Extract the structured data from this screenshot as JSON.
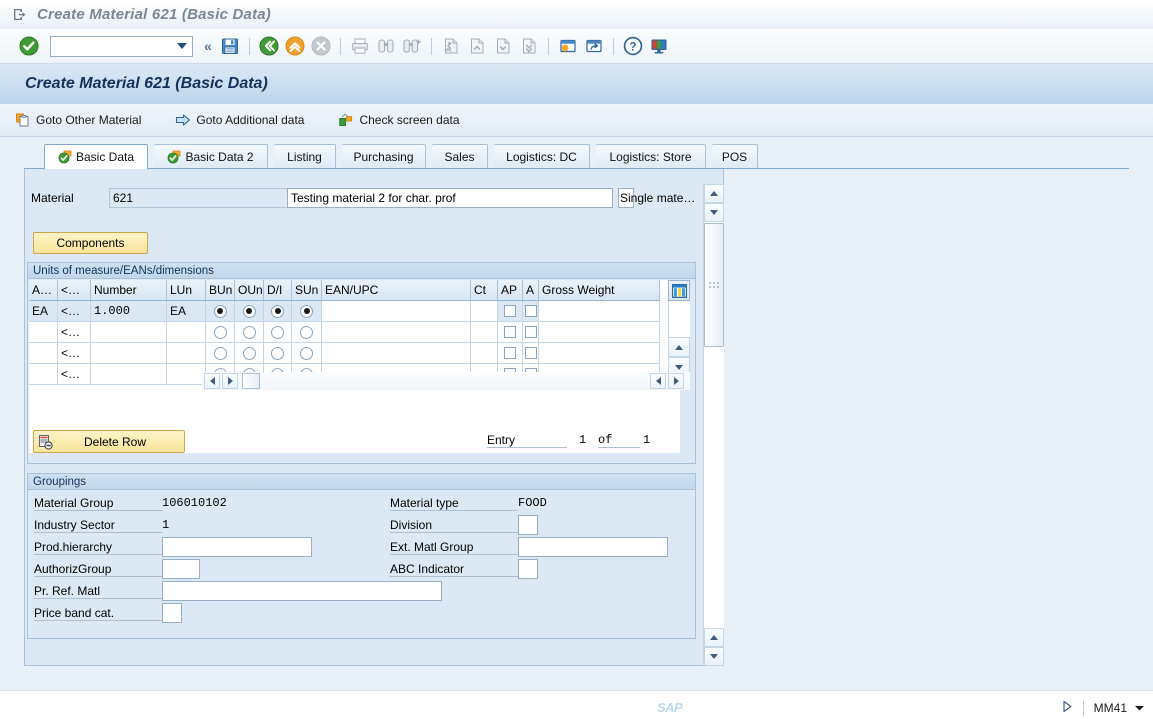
{
  "window": {
    "title": "Create Material 621 (Basic Data)",
    "icon": "sap-window-icon"
  },
  "system_toolbar": {
    "enter_icon": "enter-check-icon",
    "command_field_value": "",
    "command_field_placeholder": "",
    "command_dropdown_icon": "chevron-down-icon",
    "collapse_icon": "collapse-double-chevron-icon",
    "save_icon": "save-floppy-icon",
    "back_icon": "back-green-icon",
    "exit_icon": "exit-up-orange-icon",
    "cancel_icon": "cancel-gray-icon",
    "print_icon": "print-icon",
    "find_icon": "find-binoculars-icon",
    "find_next_icon": "find-next-binoculars-icon",
    "first_page_icon": "first-page-icon",
    "previous_page_icon": "previous-page-icon",
    "next_page_icon": "next-page-icon",
    "last_page_icon": "last-page-icon",
    "new_session_icon": "create-session-icon",
    "shortcut_icon": "create-shortcut-icon",
    "help_icon": "help-question-icon",
    "layout_menu_icon": "customize-layout-icon"
  },
  "screen": {
    "title": "Create Material 621 (Basic Data)"
  },
  "app_toolbar": {
    "buttons": [
      {
        "label": "Goto Other Material",
        "icon": "other-material-icon"
      },
      {
        "label": "Goto Additional data",
        "icon": "arrow-right-blue-icon"
      },
      {
        "label": "Check screen data",
        "icon": "check-screen-icon"
      }
    ]
  },
  "tabs": [
    {
      "label": "Basic Data",
      "active": true,
      "icon": "tab-check-icon"
    },
    {
      "label": "Basic Data 2",
      "active": false,
      "icon": "tab-check-icon"
    },
    {
      "label": "Listing",
      "active": false,
      "icon": null
    },
    {
      "label": "Purchasing",
      "active": false,
      "icon": null
    },
    {
      "label": "Sales",
      "active": false,
      "icon": null
    },
    {
      "label": "Logistics: DC",
      "active": false,
      "icon": null
    },
    {
      "label": "Logistics: Store",
      "active": false,
      "icon": null
    },
    {
      "label": "POS",
      "active": false,
      "icon": null
    }
  ],
  "form": {
    "material_label": "Material",
    "material_value": "621",
    "description_value": "Testing material 2 for char. prof",
    "single_material_label": "Single mate…",
    "single_material_value": "",
    "components_button": "Components"
  },
  "units_group": {
    "title": "Units of measure/EANs/dimensions",
    "column_config_icon": "table-settings-icon",
    "columns": [
      "A…",
      "<…",
      "Number",
      "LUn",
      "BUn",
      "OUn",
      "D/I",
      "SUn",
      "EAN/UPC",
      "Ct",
      "AP",
      "A",
      "Gross Weight"
    ],
    "rows": [
      {
        "selected": true,
        "aunit": "EA",
        "arrow": "<…",
        "number": "1.000",
        "lun": "EA",
        "bun": true,
        "oun": true,
        "di": true,
        "sun": true,
        "ean": "",
        "ct": "",
        "ap": false,
        "a": false,
        "gross_weight": ""
      },
      {
        "selected": false,
        "aunit": "",
        "arrow": "<…",
        "number": "",
        "lun": "",
        "bun": false,
        "oun": false,
        "di": false,
        "sun": false,
        "ean": "",
        "ct": "",
        "ap": false,
        "a": false,
        "gross_weight": ""
      },
      {
        "selected": false,
        "aunit": "",
        "arrow": "<…",
        "number": "",
        "lun": "",
        "bun": false,
        "oun": false,
        "di": false,
        "sun": false,
        "ean": "",
        "ct": "",
        "ap": false,
        "a": false,
        "gross_weight": ""
      },
      {
        "selected": false,
        "aunit": "",
        "arrow": "<…",
        "number": "",
        "lun": "",
        "bun": false,
        "oun": false,
        "di": false,
        "sun": false,
        "ean": "",
        "ct": "",
        "ap": false,
        "a": false,
        "gross_weight": ""
      }
    ],
    "delete_row_button": "Delete Row",
    "delete_row_icon": "delete-row-icon",
    "entry_label": "Entry",
    "entry_current": "1",
    "entry_of_label": "of",
    "entry_total": "1"
  },
  "groupings": {
    "title": "Groupings",
    "fields": [
      {
        "label": "Material Group",
        "value": "106010102",
        "kind": "text",
        "col": "left"
      },
      {
        "label": "Material type",
        "value": "FOOD",
        "kind": "text",
        "col": "right"
      },
      {
        "label": "Industry Sector",
        "value": "1",
        "kind": "text",
        "col": "left"
      },
      {
        "label": "Division",
        "value": "",
        "kind": "input-xs",
        "col": "right"
      },
      {
        "label": "Prod.hierarchy",
        "value": "",
        "kind": "input-lg",
        "col": "left"
      },
      {
        "label": "Ext. Matl Group",
        "value": "",
        "kind": "input-lg",
        "col": "right"
      },
      {
        "label": "AuthorizGroup",
        "value": "",
        "kind": "input-sm",
        "col": "left"
      },
      {
        "label": "ABC Indicator",
        "value": "",
        "kind": "input-xs",
        "col": "right"
      },
      {
        "label": "Pr. Ref. Matl",
        "value": "",
        "kind": "input-xl",
        "col": "left"
      },
      {
        "label": "Price band cat.",
        "value": "",
        "kind": "input-xs",
        "col": "left"
      }
    ]
  },
  "statusbar": {
    "logo": "SAP",
    "expand_icon": "status-expand-icon",
    "transaction": "MM41",
    "dropdown_icon": "chevron-down-icon"
  },
  "colors": {
    "title_text": "#7a8694",
    "screen_title_text": "#14335c",
    "panel_bg": "#dce8f3",
    "content_bg": "#e8f0f7",
    "button_yellow": "#f7e49a",
    "accent_blue": "#1e4d7b",
    "sap_logo": "#bdd9ee"
  }
}
